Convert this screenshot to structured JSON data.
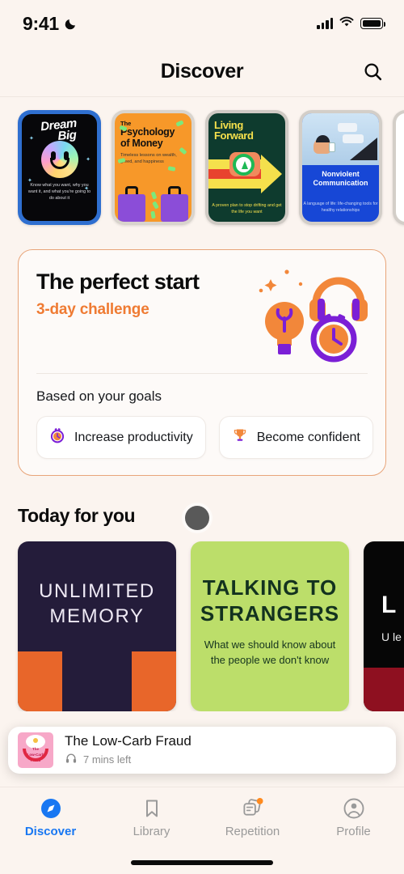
{
  "status_bar": {
    "time": "9:41",
    "dnd_icon": "moon-icon",
    "signal_icon": "cellular-bars-icon",
    "wifi_icon": "wifi-icon",
    "battery_icon": "battery-full-icon"
  },
  "header": {
    "title": "Discover",
    "search_icon": "search-icon"
  },
  "book_strip": [
    {
      "title": "Dream Big",
      "title_line1": "Dream",
      "title_line2": "Big",
      "subtitle": "Know what you want, why you want it, and what you're going to do about it",
      "cover_bg": "#07070A",
      "frame_color": "#2F6FD0"
    },
    {
      "title_small": "The",
      "title": "Psychology of Money",
      "title_line1": "Psychology",
      "title_line2": "of Money",
      "subtitle": "Timeless lessons on wealth, greed, and happiness",
      "cover_bg": "#F79829"
    },
    {
      "title": "Living Forward",
      "title_line1": "Living",
      "title_line2": "Forward",
      "subtitle": "A proven plan to stop drifting and get the life you want",
      "cover_bg": "#0E3B2E"
    },
    {
      "title": "Nonviolent Communication",
      "title_line1": "Nonviolent",
      "title_line2": "Communication",
      "subtitle": "A language of life: life-changing tools for healthy relationships",
      "cover_bg": "#1747D6"
    },
    {
      "title": "",
      "cover_bg": "#FFFFFF"
    }
  ],
  "challenge_card": {
    "title": "The perfect start",
    "subtitle": "3-day challenge",
    "accent_color": "#EF7B33",
    "border_color": "#E8A57A",
    "illustration_icons": [
      "headphones-icon",
      "lightbulb-icon",
      "clock-icon",
      "sparkle-icon"
    ],
    "goals_label": "Based on your goals",
    "goals": [
      {
        "label": "Increase productivity",
        "icon": "stopwatch-icon"
      },
      {
        "label": "Become confident",
        "icon": "trophy-icon"
      }
    ]
  },
  "today_section": {
    "title": "Today for you",
    "cards": [
      {
        "title_line1": "UNLIMITED",
        "title_line2": "MEMORY",
        "subtitle": "",
        "bg": "#241C3A"
      },
      {
        "title_line1": "TALKING TO",
        "title_line2": "STRANGERS",
        "subtitle": "What we should know about the people we don't know",
        "bg": "#BCDE6A"
      },
      {
        "title_line1": "L",
        "subtitle": "U le",
        "bg": "#060606"
      }
    ]
  },
  "mini_player": {
    "title": "The Low-Carb Fraud",
    "time_left": "7 mins left",
    "audio_icon": "headphones-icon",
    "thumb_label_line1": "The",
    "thumb_label_line2": "Low-Carb",
    "thumb_label_line3": "Fraud"
  },
  "bottom_nav": {
    "active_color": "#1877F2",
    "inactive_color": "#9A9A9A",
    "badge_color": "#FF8A1E",
    "items": [
      {
        "label": "Discover",
        "icon": "compass-icon",
        "active": true,
        "badge": false
      },
      {
        "label": "Library",
        "icon": "bookmark-icon",
        "active": false,
        "badge": false
      },
      {
        "label": "Repetition",
        "icon": "cards-icon",
        "active": false,
        "badge": true
      },
      {
        "label": "Profile",
        "icon": "person-circle-icon",
        "active": false,
        "badge": false
      }
    ]
  },
  "cursor": {
    "visible": true
  }
}
